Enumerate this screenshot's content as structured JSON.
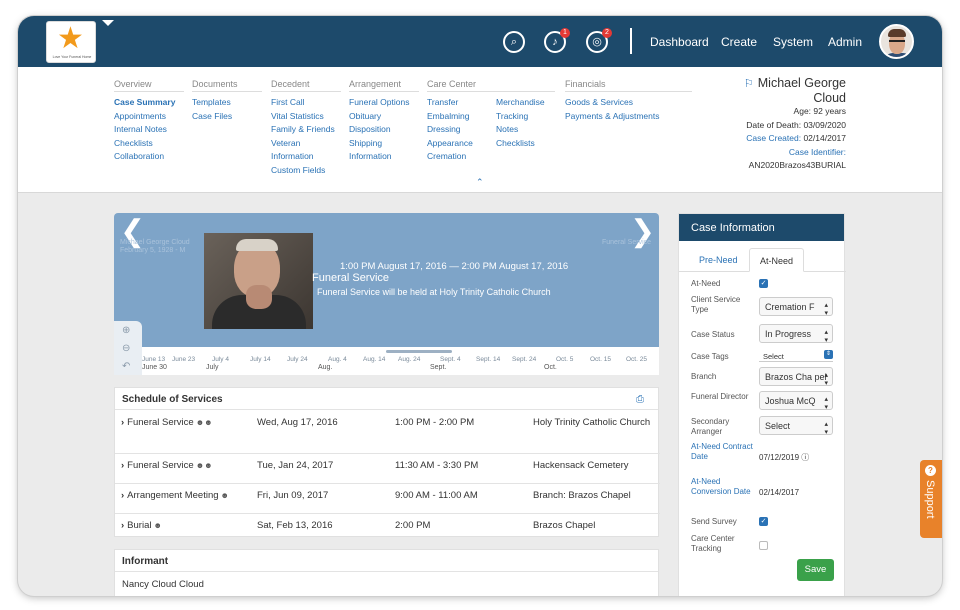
{
  "logo": {
    "tagline": "Love Your Funeral Home"
  },
  "header": {
    "nav": [
      "Dashboard",
      "Create",
      "System",
      "Admin"
    ],
    "notifications_badge": "1",
    "tasks_badge": "2"
  },
  "menu": {
    "columns": [
      {
        "heading": "Overview",
        "items": [
          "Case Summary",
          "Appointments",
          "Internal Notes",
          "Checklists",
          "Collaboration"
        ]
      },
      {
        "heading": "Documents",
        "items": [
          "Templates",
          "Case Files"
        ]
      },
      {
        "heading": "Decedent",
        "items": [
          "First Call",
          "Vital Statistics",
          "Family & Friends",
          "Veteran",
          "Information",
          "Custom Fields"
        ]
      },
      {
        "heading": "Arrangement",
        "items": [
          "Funeral Options",
          "Obituary",
          "Disposition",
          "Shipping",
          "Information"
        ]
      },
      {
        "heading": "Care Center",
        "items": [
          "Transfer",
          "Embalming",
          "Dressing",
          "Appearance",
          "Cremation"
        ]
      },
      {
        "heading": "",
        "items": [
          "Merchandise",
          "Tracking",
          "Notes",
          "Checklists"
        ]
      },
      {
        "heading": "Financials",
        "items": [
          "Goods & Services",
          "Payments & Adjustments"
        ]
      }
    ]
  },
  "person": {
    "name_line1": "Michael George",
    "name_line2": "Cloud",
    "age": "Age: 92 years",
    "dod": "Date of Death: 03/09/2020",
    "created_label": "Case Created:",
    "created_value": "02/14/2017",
    "identifier_label": "Case Identifier:",
    "identifier_value": "AN2020Brazos43BURIAL"
  },
  "timeline": {
    "ghost_left_1": "Michael George Cloud",
    "ghost_left_2": "February 5, 1928 - M",
    "ghost_right": "Funeral Service",
    "time": "1:00 PM August 17, 2016 — 2:00 PM August 17, 2016",
    "title": "Funeral Service",
    "description": "Funeral Service will be held at Holy Trinity Catholic Church",
    "ticks": [
      "June 13",
      "June 23",
      "July 4",
      "July 14",
      "July 24",
      "Aug. 4",
      "Aug. 14",
      "Aug. 24",
      "Sept. 4",
      "Sept. 14",
      "Sept. 24",
      "Oct. 5",
      "Oct. 15",
      "Oct. 25"
    ],
    "months": [
      "June 30",
      "July",
      "Aug.",
      "Sept.",
      "Oct."
    ]
  },
  "schedule": {
    "title": "Schedule of Services",
    "rows": [
      {
        "name": "Funeral Service",
        "date": "Wed, Aug 17, 2016",
        "time": "1:00 PM - 2:00 PM",
        "location": "Holy Trinity Catholic Church"
      },
      {
        "name": "Funeral Service",
        "date": "Tue, Jan 24, 2017",
        "time": "11:30 AM - 3:30 PM",
        "location": "Hackensack Cemetery"
      },
      {
        "name": "Arrangement Meeting",
        "date": "Fri, Jun 09, 2017",
        "time": "9:00 AM - 11:00 AM",
        "location": "Branch: Brazos Chapel"
      },
      {
        "name": "Burial",
        "date": "Sat, Feb 13, 2016",
        "time": "2:00 PM",
        "location": "Brazos Chapel"
      }
    ]
  },
  "informant": {
    "title": "Informant",
    "name": "Nancy Cloud Cloud"
  },
  "case_info": {
    "title": "Case Information",
    "tab_preneed": "Pre-Need",
    "tab_atneed": "At-Need",
    "labels": {
      "at_need": "At-Need",
      "service_type": "Client Service Type",
      "status": "Case Status",
      "tags": "Case Tags",
      "branch": "Branch",
      "director": "Funeral Director",
      "secondary": "Secondary Arranger",
      "contract_date": "At-Need Contract Date",
      "conversion_date": "At-Need Conversion Date",
      "send_survey": "Send Survey",
      "care_tracking": "Care Center Tracking"
    },
    "values": {
      "service_type": "Cremation F",
      "status": "In Progress",
      "tags": "Select",
      "branch": "Brazos Cha pel",
      "director": "Joshua McQ",
      "secondary": "Select",
      "contract_date": "07/12/2019",
      "conversion_date": "02/14/2017"
    },
    "save": "Save"
  },
  "support": "Support"
}
